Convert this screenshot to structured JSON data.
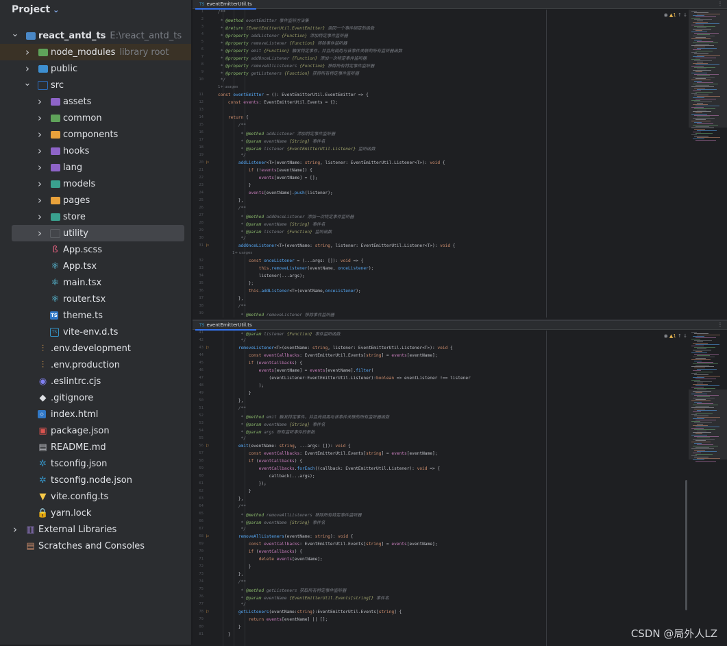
{
  "project_panel": {
    "title": "Project",
    "tree": [
      {
        "label": "react_antd_ts",
        "suffix": "E:\\react_antd_ts",
        "indent": 0,
        "arrow": "expanded",
        "icon": "folder-module",
        "bold": true
      },
      {
        "label": "node_modules",
        "suffix": "library root",
        "indent": 1,
        "arrow": "collapsed",
        "icon": "folder-green",
        "highlight": "library"
      },
      {
        "label": "public",
        "indent": 1,
        "arrow": "collapsed",
        "icon": "folder-web"
      },
      {
        "label": "src",
        "indent": 1,
        "arrow": "expanded",
        "icon": "folder-source"
      },
      {
        "label": "assets",
        "indent": 2,
        "arrow": "collapsed",
        "icon": "folder-purple"
      },
      {
        "label": "common",
        "indent": 2,
        "arrow": "collapsed",
        "icon": "folder-green"
      },
      {
        "label": "components",
        "indent": 2,
        "arrow": "collapsed",
        "icon": "folder-orange"
      },
      {
        "label": "hooks",
        "indent": 2,
        "arrow": "collapsed",
        "icon": "folder-purple"
      },
      {
        "label": "lang",
        "indent": 2,
        "arrow": "collapsed",
        "icon": "folder-purple"
      },
      {
        "label": "models",
        "indent": 2,
        "arrow": "collapsed",
        "icon": "folder-teal"
      },
      {
        "label": "pages",
        "indent": 2,
        "arrow": "collapsed",
        "icon": "folder-orange"
      },
      {
        "label": "store",
        "indent": 2,
        "arrow": "collapsed",
        "icon": "folder-teal"
      },
      {
        "label": "utility",
        "indent": 2,
        "arrow": "collapsed",
        "icon": "folder-plain",
        "selected": true
      },
      {
        "label": "App.scss",
        "indent": 2,
        "icon": "sass"
      },
      {
        "label": "App.tsx",
        "indent": 2,
        "icon": "react"
      },
      {
        "label": "main.tsx",
        "indent": 2,
        "icon": "react"
      },
      {
        "label": "router.tsx",
        "indent": 2,
        "icon": "react"
      },
      {
        "label": "theme.ts",
        "indent": 2,
        "icon": "ts"
      },
      {
        "label": "vite-env.d.ts",
        "indent": 2,
        "icon": "ts-outline"
      },
      {
        "label": ".env.development",
        "indent": 1,
        "icon": "env"
      },
      {
        "label": ".env.production",
        "indent": 1,
        "icon": "env"
      },
      {
        "label": ".eslintrc.cjs",
        "indent": 1,
        "icon": "eslint"
      },
      {
        "label": ".gitignore",
        "indent": 1,
        "icon": "git"
      },
      {
        "label": "index.html",
        "indent": 1,
        "icon": "html"
      },
      {
        "label": "package.json",
        "indent": 1,
        "icon": "npm"
      },
      {
        "label": "README.md",
        "indent": 1,
        "icon": "markdown"
      },
      {
        "label": "tsconfig.json",
        "indent": 1,
        "icon": "tsconfig"
      },
      {
        "label": "tsconfig.node.json",
        "indent": 1,
        "icon": "tsconfig"
      },
      {
        "label": "vite.config.ts",
        "indent": 1,
        "icon": "vite"
      },
      {
        "label": "yarn.lock",
        "indent": 1,
        "icon": "lock"
      },
      {
        "label": "External Libraries",
        "indent": 0,
        "arrow": "collapsed",
        "icon": "libraries"
      },
      {
        "label": "Scratches and Consoles",
        "indent": 0,
        "icon": "scratches"
      }
    ]
  },
  "editors": [
    {
      "tab": "eventEmitterUtil.ts",
      "status": {
        "warnings": "1"
      },
      "lines": [
        {
          "n": "1",
          "t": "/**"
        },
        {
          "n": "2",
          "t": " * @method eventEmitter 事件监听方法集"
        },
        {
          "n": "3",
          "t": " * @return {EventEmitterUtil.EventEmitter} 返回一个事件绑定的函数"
        },
        {
          "n": "4",
          "t": " * @property addListener {Function} 添加特定事件监听器"
        },
        {
          "n": "5",
          "t": " * @property removeListener {Function} 移除事件监听器"
        },
        {
          "n": "6",
          "t": " * @property emit {Function} 触发特定事件，并且向调用与该事件关联的所有监听器函数"
        },
        {
          "n": "7",
          "t": " * @property addOnceListener {Function} 添加一次特定事件监听器"
        },
        {
          "n": "8",
          "t": " * @property removeAllListeners {Function} 移除所有特定事件监听器"
        },
        {
          "n": "9",
          "t": " * @property getListeners {Function} 获得所有特定事件监听器"
        },
        {
          "n": "10",
          "t": " */"
        },
        {
          "n": "",
          "t": "1+ usages",
          "hint": true
        },
        {
          "n": "11",
          "t": "const eventEmitter = (): EventEmitterUtil.EventEmitter => {"
        },
        {
          "n": "12",
          "t": "    const events: EventEmitterUtil.Events = {};"
        },
        {
          "n": "13",
          "t": ""
        },
        {
          "n": "14",
          "t": "    return {"
        },
        {
          "n": "15",
          "t": "        /**"
        },
        {
          "n": "16",
          "t": "         * @method addListener 添加特定事件监听器"
        },
        {
          "n": "17",
          "t": "         * @param eventName {String} 事件名"
        },
        {
          "n": "18",
          "t": "         * @param listener {EventEmitterUtil.Listener} 监听函数"
        },
        {
          "n": "19",
          "t": "         */"
        },
        {
          "n": "20",
          "t": "        addListener<T>(eventName: string, listener: EventEmitterUtil.Listener<T>): void {",
          "mark": true
        },
        {
          "n": "21",
          "t": "            if (!events[eventName]) {"
        },
        {
          "n": "22",
          "t": "                events[eventName] = [];"
        },
        {
          "n": "23",
          "t": "            }"
        },
        {
          "n": "24",
          "t": "            events[eventName].push(listener);"
        },
        {
          "n": "25",
          "t": "        },"
        },
        {
          "n": "26",
          "t": "        /**"
        },
        {
          "n": "27",
          "t": "         * @method addOnceListener 添加一次特定事件监听器"
        },
        {
          "n": "28",
          "t": "         * @param eventName {String} 事件名"
        },
        {
          "n": "29",
          "t": "         * @param listener {Function} 监听函数"
        },
        {
          "n": "30",
          "t": "         */"
        },
        {
          "n": "31",
          "t": "        addOnceListener<T>(eventName: string, listener: EventEmitterUtil.Listener<T>): void {",
          "mark": true
        },
        {
          "n": "",
          "t": "            1+ usages",
          "hint": true
        },
        {
          "n": "32",
          "t": "            const onceListener = (...args: []): void => {"
        },
        {
          "n": "33",
          "t": "                this.removeListener(eventName, onceListener);"
        },
        {
          "n": "34",
          "t": "                listener(...args);"
        },
        {
          "n": "35",
          "t": "            };"
        },
        {
          "n": "36",
          "t": "            this.addListener<T>(eventName,onceListener);"
        },
        {
          "n": "37",
          "t": "        },"
        },
        {
          "n": "38",
          "t": "        /**"
        },
        {
          "n": "39",
          "t": "         * @method removeListener 移除事件监听器"
        }
      ]
    },
    {
      "tab": "eventEmitterUtil.ts",
      "status": {
        "warnings": "1"
      },
      "lines": [
        {
          "n": "41",
          "t": "         * @param listener {Function} 事件监听函数"
        },
        {
          "n": "42",
          "t": "         */"
        },
        {
          "n": "43",
          "t": "        removeListener<T>(eventName: string, listener: EventEmitterUtil.Listener<T>): void {",
          "mark": true
        },
        {
          "n": "44",
          "t": "            const eventCallbacks: EventEmitterUtil.Events[string] = events[eventName];"
        },
        {
          "n": "45",
          "t": "            if (eventCallbacks) {"
        },
        {
          "n": "46",
          "t": "                events[eventName] = events[eventName].filter("
        },
        {
          "n": "47",
          "t": "                    (eventListener:EventEmitterUtil.Listener):boolean => eventListener !== listener"
        },
        {
          "n": "48",
          "t": "                );"
        },
        {
          "n": "49",
          "t": "            }"
        },
        {
          "n": "50",
          "t": "        },"
        },
        {
          "n": "51",
          "t": "        /**"
        },
        {
          "n": "52",
          "t": "         * @method emit 触发特定事件，并且向调用与该事件关联的所有监听器函数"
        },
        {
          "n": "53",
          "t": "         * @param eventName {String} 事件名"
        },
        {
          "n": "54",
          "t": "         * @param args 所有监听事件的参数"
        },
        {
          "n": "55",
          "t": "         */"
        },
        {
          "n": "56",
          "t": "        emit(eventName: string, ...args: []): void {",
          "mark": true
        },
        {
          "n": "57",
          "t": "            const eventCallbacks: EventEmitterUtil.Events[string] = events[eventName];"
        },
        {
          "n": "58",
          "t": "            if (eventCallbacks) {"
        },
        {
          "n": "59",
          "t": "                eventCallbacks.forEach((callback: EventEmitterUtil.Listener): void => {"
        },
        {
          "n": "60",
          "t": "                    callback(...args);"
        },
        {
          "n": "61",
          "t": "                });"
        },
        {
          "n": "62",
          "t": "            }"
        },
        {
          "n": "63",
          "t": "        },"
        },
        {
          "n": "64",
          "t": "        /**"
        },
        {
          "n": "65",
          "t": "         * @method removeAllListeners 移除所有特定事件监听器"
        },
        {
          "n": "66",
          "t": "         * @param eventName {String} 事件名"
        },
        {
          "n": "67",
          "t": "         */"
        },
        {
          "n": "68",
          "t": "        removeAllListeners(eventName: string): void {",
          "mark": true
        },
        {
          "n": "69",
          "t": "            const eventCallbacks: EventEmitterUtil.Events[string] = events[eventName];"
        },
        {
          "n": "70",
          "t": "            if (eventCallbacks) {"
        },
        {
          "n": "71",
          "t": "                delete events[eventName];"
        },
        {
          "n": "72",
          "t": "            }"
        },
        {
          "n": "73",
          "t": "        },"
        },
        {
          "n": "74",
          "t": "        /**"
        },
        {
          "n": "75",
          "t": "         * @method getListeners 获取所有特定事件监听器"
        },
        {
          "n": "76",
          "t": "         * @param eventName {EventEmitterUtil.Events[string]} 事件名"
        },
        {
          "n": "77",
          "t": "         */"
        },
        {
          "n": "78",
          "t": "        getListeners(eventName:string):EventEmitterUtil.Events[string] {",
          "mark": true
        },
        {
          "n": "79",
          "t": "            return events[eventName] || [];"
        },
        {
          "n": "80",
          "t": "        }"
        },
        {
          "n": "81",
          "t": "    }"
        }
      ]
    }
  ],
  "watermark": "CSDN @局外人LZ",
  "colors": {
    "keyword": "#cf8e6d",
    "type": "#bcbec4",
    "comment": "#7a7e85",
    "tag": "#8ab86c",
    "method": "#56a8f5",
    "string": "#6aab73",
    "docparam": "#9a9d69",
    "variable": "#c77dbb",
    "accent": "#3574f0"
  }
}
